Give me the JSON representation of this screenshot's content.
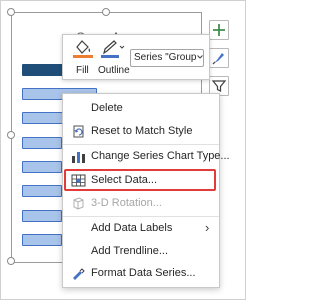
{
  "chart": {
    "title": "Group A",
    "series_dropdown": "Series \"Group-A\""
  },
  "mini_toolbar": {
    "fill_label": "Fill",
    "outline_label": "Outline"
  },
  "context_menu": {
    "items": [
      {
        "label": "Delete",
        "icon": "delete-icon"
      },
      {
        "label": "Reset to Match Style",
        "icon": "reset-style-icon"
      },
      {
        "label": "Change Series Chart Type...",
        "icon": "chart-type-icon"
      },
      {
        "label": "Select Data...",
        "icon": "select-data-icon"
      },
      {
        "label": "3-D Rotation...",
        "icon": "3d-rotation-icon"
      },
      {
        "label": "Add Data Labels",
        "icon": "data-labels-icon"
      },
      {
        "label": "Add Trendline...",
        "icon": "trendline-icon"
      },
      {
        "label": "Format Data Series...",
        "icon": "format-series-icon"
      }
    ],
    "submenu_arrow": "›"
  },
  "colors": {
    "fill_accent": "#ed7d31",
    "outline_accent": "#4472c4",
    "highlight": "#e33a3a",
    "bar_dark": "#1f4e79",
    "bar_light": "#a9c4ea",
    "side_button_icons": "#3f8f4f"
  }
}
